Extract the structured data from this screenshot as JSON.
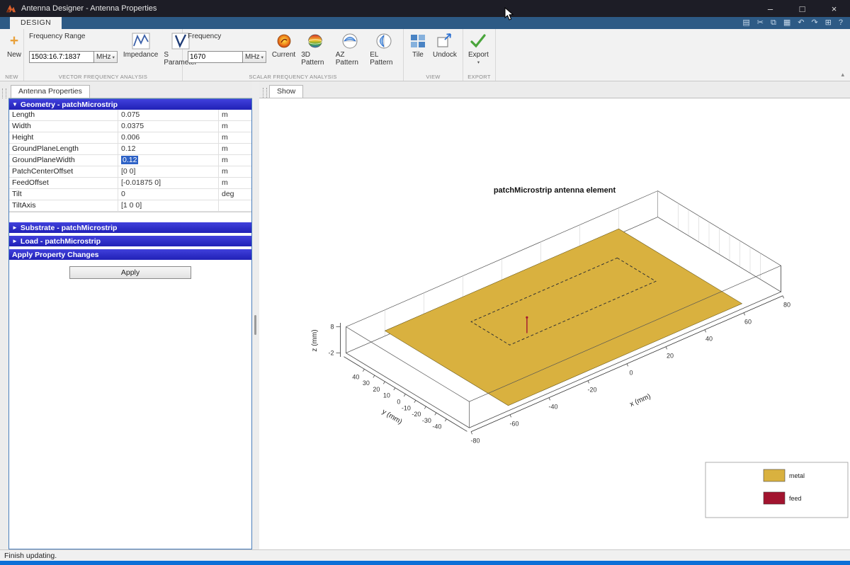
{
  "titlebar": {
    "title": "Antenna Designer - Antenna Properties",
    "controls": [
      {
        "name": "minimize",
        "glyph": "–"
      },
      {
        "name": "maximize",
        "glyph": "□"
      },
      {
        "name": "close",
        "glyph": "×"
      }
    ]
  },
  "ribbon": {
    "tab": "DESIGN",
    "caret": "▾",
    "collapse_glyph": "▴",
    "quick_icons": [
      {
        "name": "save",
        "glyph": "▤"
      },
      {
        "name": "cut",
        "glyph": "✂"
      },
      {
        "name": "copy",
        "glyph": "⧉"
      },
      {
        "name": "paste",
        "glyph": "▦"
      },
      {
        "name": "undo",
        "glyph": "↶"
      },
      {
        "name": "redo",
        "glyph": "↷"
      },
      {
        "name": "layout",
        "glyph": "⊞"
      },
      {
        "name": "help",
        "glyph": "?"
      }
    ],
    "sections": [
      {
        "label": "NEW"
      },
      {
        "label": "VECTOR FREQUENCY ANALYSIS"
      },
      {
        "label": "SCALAR FREQUENCY ANALYSIS"
      },
      {
        "label": "VIEW"
      },
      {
        "label": "EXPORT"
      }
    ],
    "new_button": "New",
    "vector": {
      "freq_range_label": "Frequency Range",
      "freq_range_value": "1503:16.7:1837",
      "unit": "MHz",
      "impedance": "Impedance",
      "s_parameter": "S Parameter"
    },
    "scalar": {
      "freq_label": "Frequency",
      "freq_value": "1670",
      "unit": "MHz",
      "current": "Current",
      "pattern3d": "3D Pattern",
      "az": "AZ Pattern",
      "el": "EL Pattern"
    },
    "view": {
      "tile": "Tile",
      "undock": "Undock"
    },
    "export": {
      "label": "Export"
    }
  },
  "left_panel": {
    "tab": "Antenna Properties",
    "geometry_header": "Geometry - patchMicrostrip",
    "substrate_header": "Substrate - patchMicrostrip",
    "load_header": "Load - patchMicrostrip",
    "apply_header": "Apply Property Changes",
    "expand_glyph": "▼",
    "collapsed_glyph": "►",
    "rows": [
      {
        "name": "Length",
        "value": "0.075",
        "unit": "m"
      },
      {
        "name": "Width",
        "value": "0.0375",
        "unit": "m"
      },
      {
        "name": "Height",
        "value": "0.006",
        "unit": "m"
      },
      {
        "name": "GroundPlaneLength",
        "value": "0.12",
        "unit": "m"
      },
      {
        "name": "GroundPlaneWidth",
        "value": "0.12",
        "unit": "m",
        "editing": true
      },
      {
        "name": "PatchCenterOffset",
        "value": "[0 0]",
        "unit": "m"
      },
      {
        "name": "FeedOffset",
        "value": "[-0.01875 0]",
        "unit": "m"
      },
      {
        "name": "Tilt",
        "value": "0",
        "unit": "deg"
      },
      {
        "name": "TiltAxis",
        "value": "[1 0 0]",
        "unit": ""
      }
    ],
    "apply_button": "Apply"
  },
  "plot_panel": {
    "tab": "Show",
    "figure": {
      "type": "3d-geometry",
      "title": "patchMicrostrip antenna element",
      "x_label": "x (mm)",
      "y_label": "y (mm)",
      "z_label": "z (mm)",
      "x_ticks": [
        -80,
        -60,
        -40,
        -20,
        0,
        20,
        40,
        60,
        80
      ],
      "y_ticks": [
        40,
        30,
        20,
        10,
        0,
        -10,
        -20,
        -30,
        -40
      ],
      "z_ticks": [
        8,
        -2
      ],
      "ground_plane_mm": [
        120,
        120
      ],
      "patch_mm": [
        75,
        37.5
      ],
      "legend": [
        {
          "label": "metal",
          "color": "#d9b13f"
        },
        {
          "label": "feed",
          "color": "#a2142f"
        }
      ]
    }
  },
  "statusbar": {
    "text": "Finish updating."
  }
}
